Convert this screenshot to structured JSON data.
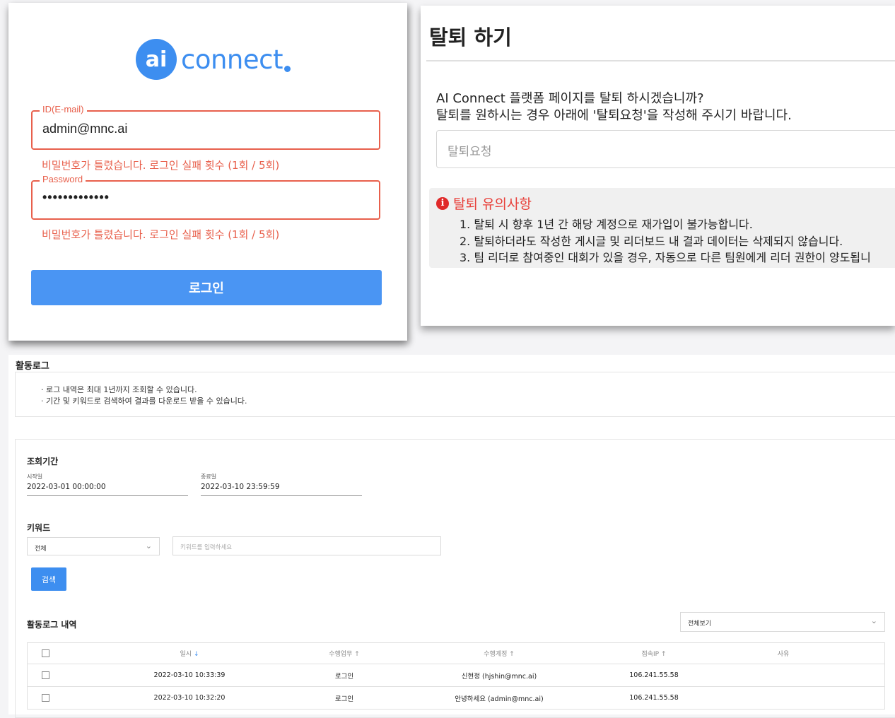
{
  "login": {
    "logo_badge": "ai",
    "logo_text": "connect",
    "id_label": "ID(E-mail)",
    "id_value": "admin@mnc.ai",
    "id_error": "비밀번호가 틀렸습니다. 로그인 실패 횟수 (1회 / 5회)",
    "password_label": "Password",
    "password_value": "•••••••••••••",
    "password_error": "비밀번호가 틀렸습니다. 로그인 실패 횟수 (1회 / 5회)",
    "login_button": "로그인",
    "accent_color": "#e8604c",
    "brand_color": "#3d8ef0"
  },
  "withdraw": {
    "title": "탈퇴 하기",
    "desc_line1": "AI Connect 플랫폼 페이지를 탈퇴 하시겠습니까?",
    "desc_line2": "탈퇴를 원하시는 경우 아래에 '탈퇴요청'을 작성해 주시기 바랍니다.",
    "input_placeholder": "탈퇴요청",
    "notice_icon": "info-icon",
    "notice_title": "탈퇴 유의사항",
    "notice_items": [
      "1. 탈퇴 시 향후 1년 간 해당 계정으로 재가입이 불가능합니다.",
      "2. 탈퇴하더라도 작성한 게시글 및 리더보드 내 결과 데이터는 삭제되지 않습니다.",
      "3. 팀 리더로 참여중인 대회가 있을 경우, 자동으로 다른 팀원에게 리더 권한이 양도됩니"
    ]
  },
  "activity_log": {
    "title": "활동로그",
    "info_lines": [
      "· 로그 내역은 최대 1년까지 조회할 수 있습니다.",
      "· 기간 및 키워드로 검색하여 결과를 다운로드 받을 수 있습니다."
    ],
    "period_label": "조회기간",
    "start_label": "시작일",
    "start_value": "2022-03-01 00:00:00",
    "end_label": "종료일",
    "end_value": "2022-03-10 23:59:59",
    "keyword_label": "키워드",
    "keyword_select": "전체",
    "keyword_placeholder": "키워드를 입력하세요",
    "search_button": "검색",
    "history_label": "활동로그 내역",
    "view_select": "전체보기",
    "columns": [
      "일시",
      "수행업무",
      "수행계정",
      "접속IP",
      "사유"
    ],
    "rows": [
      {
        "datetime": "2022-03-10 10:33:39",
        "task": "로그인",
        "account": "신현정 (hjshin@mnc.ai)",
        "ip": "106.241.55.58",
        "reason": ""
      },
      {
        "datetime": "2022-03-10 10:32:20",
        "task": "로그인",
        "account": "안녕하세요 (admin@mnc.ai)",
        "ip": "106.241.55.58",
        "reason": ""
      }
    ]
  }
}
